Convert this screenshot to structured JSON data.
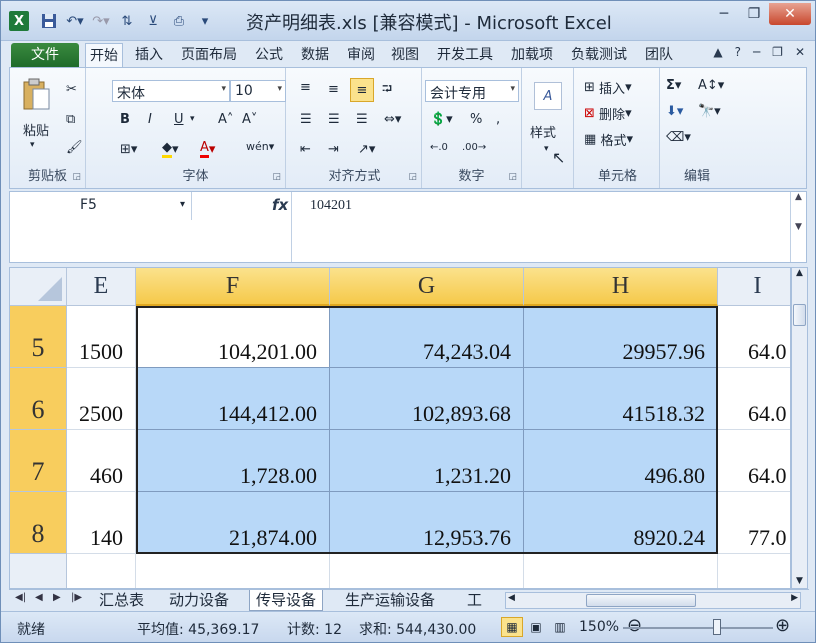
{
  "titlebar": {
    "title": "资产明细表.xls  [兼容模式]  -  Microsoft Excel",
    "logo": "X",
    "qat_icons": [
      "save-icon",
      "undo-icon",
      "redo-icon",
      "quick-access-tools"
    ]
  },
  "tabs": [
    "文件",
    "开始",
    "插入",
    "页面布局",
    "公式",
    "数据",
    "审阅",
    "视图",
    "开发工具",
    "加载项",
    "负载测试",
    "团队"
  ],
  "ribbon": {
    "clipboard": {
      "paste": "粘贴",
      "label": "剪贴板"
    },
    "font": {
      "name": "宋体",
      "size": "10",
      "label": "字体",
      "bold": "B",
      "italic": "I",
      "underline": "U"
    },
    "alignment": {
      "label": "对齐方式"
    },
    "number": {
      "format": "会计专用",
      "label": "数字",
      "percent": "%"
    },
    "styles": {
      "label": "样式"
    },
    "cells": {
      "insert": "插入",
      "delete": "删除",
      "format": "格式",
      "label": "单元格"
    },
    "editing": {
      "label": "编辑",
      "sum": "Σ"
    }
  },
  "formula_bar": {
    "name_box": "F5",
    "fx": "fx",
    "value": "104201"
  },
  "columns": [
    {
      "id": "E",
      "selected": false
    },
    {
      "id": "F",
      "selected": true
    },
    {
      "id": "G",
      "selected": true
    },
    {
      "id": "H",
      "selected": true
    },
    {
      "id": "I",
      "selected": false
    }
  ],
  "rows": [
    {
      "id": "5",
      "cells": [
        "1500",
        "104,201.00",
        "74,243.04",
        "29957.96",
        "64.0"
      ]
    },
    {
      "id": "6",
      "cells": [
        "2500",
        "144,412.00",
        "102,893.68",
        "41518.32",
        "64.0"
      ]
    },
    {
      "id": "7",
      "cells": [
        "460",
        "1,728.00",
        "1,231.20",
        "496.80",
        "64.0"
      ]
    },
    {
      "id": "8",
      "cells": [
        "140",
        "21,874.00",
        "12,953.76",
        "8920.24",
        "77.0"
      ]
    }
  ],
  "sheets": [
    "汇总表",
    "动力设备",
    "传导设备",
    "生产运输设备",
    "工"
  ],
  "active_sheet": "传导设备",
  "status": {
    "ready": "就绪",
    "average": "平均值: 45,369.17",
    "count": "计数: 12",
    "sum": "求和: 544,430.00",
    "zoom": "150%"
  }
}
